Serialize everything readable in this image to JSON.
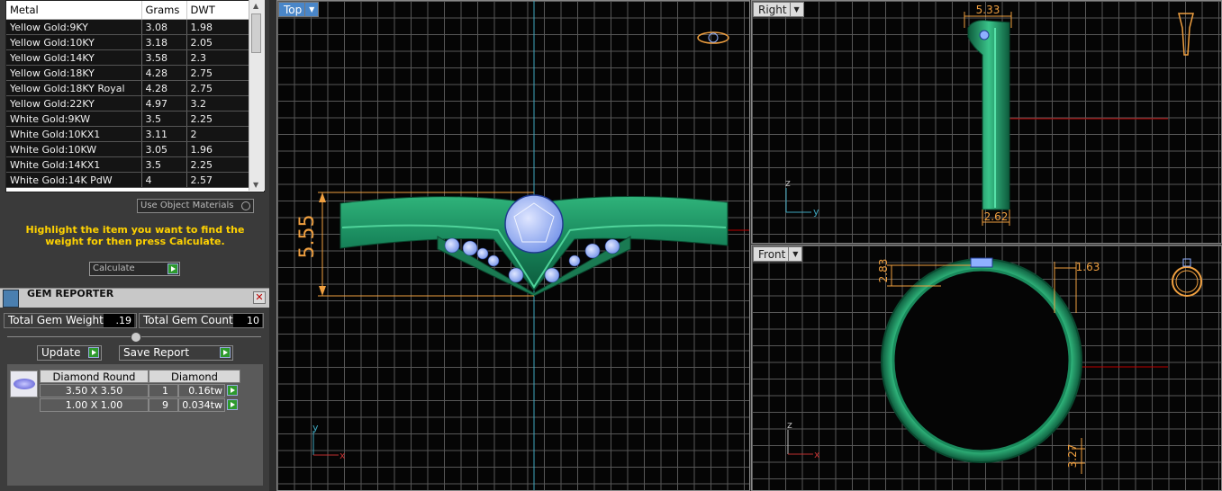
{
  "metal_table": {
    "headers": [
      "Metal",
      "Grams",
      "DWT"
    ],
    "rows": [
      [
        "Yellow Gold:9KY",
        "3.08",
        "1.98"
      ],
      [
        "Yellow Gold:10KY",
        "3.18",
        "2.05"
      ],
      [
        "Yellow Gold:14KY",
        "3.58",
        "2.3"
      ],
      [
        "Yellow Gold:18KY",
        "4.28",
        "2.75"
      ],
      [
        "Yellow Gold:18KY Royal",
        "4.28",
        "2.75"
      ],
      [
        "Yellow Gold:22KY",
        "4.97",
        "3.2"
      ],
      [
        "White Gold:9KW",
        "3.5",
        "2.25"
      ],
      [
        "White Gold:10KX1",
        "3.11",
        "2"
      ],
      [
        "White Gold:10KW",
        "3.05",
        "1.96"
      ],
      [
        "White Gold:14KX1",
        "3.5",
        "2.25"
      ],
      [
        "White Gold:14K PdW",
        "4",
        "2.57"
      ]
    ]
  },
  "use_object_materials": "Use Object Materials",
  "hint": "Highlight the item you want to find the weight for then press Calculate.",
  "calculate_label": "Calculate",
  "gem_reporter": {
    "title": "GEM REPORTER",
    "total_weight_label": "Total Gem Weight",
    "total_weight_value": ".19",
    "total_count_label": "Total Gem Count",
    "total_count_value": "10",
    "update_label": "Update",
    "save_label": "Save Report",
    "headers": [
      "Diamond Round",
      "Diamond"
    ],
    "rows": [
      {
        "size": "3.50 X 3.50",
        "count": "1",
        "weight": "0.16tw"
      },
      {
        "size": "1.00 X 1.00",
        "count": "9",
        "weight": "0.034tw"
      }
    ]
  },
  "viewports": {
    "top": {
      "label": "Top",
      "dimension": "5.55",
      "axis_x": "x",
      "axis_y": "y"
    },
    "right": {
      "label": "Right",
      "dim_top": "5.33",
      "dim_bottom": "2.62",
      "axis_z": "z",
      "axis_y": "y"
    },
    "front": {
      "label": "Front",
      "dim_left": "2.83",
      "dim_right": "1.63",
      "dim_bottom": "3.27",
      "axis_z": "z",
      "axis_x": "x"
    }
  },
  "colors": {
    "ring": "#1f8a5c",
    "gem": "#8fb0ff",
    "dimension": "#f0a040",
    "active": "#4a86c8"
  }
}
